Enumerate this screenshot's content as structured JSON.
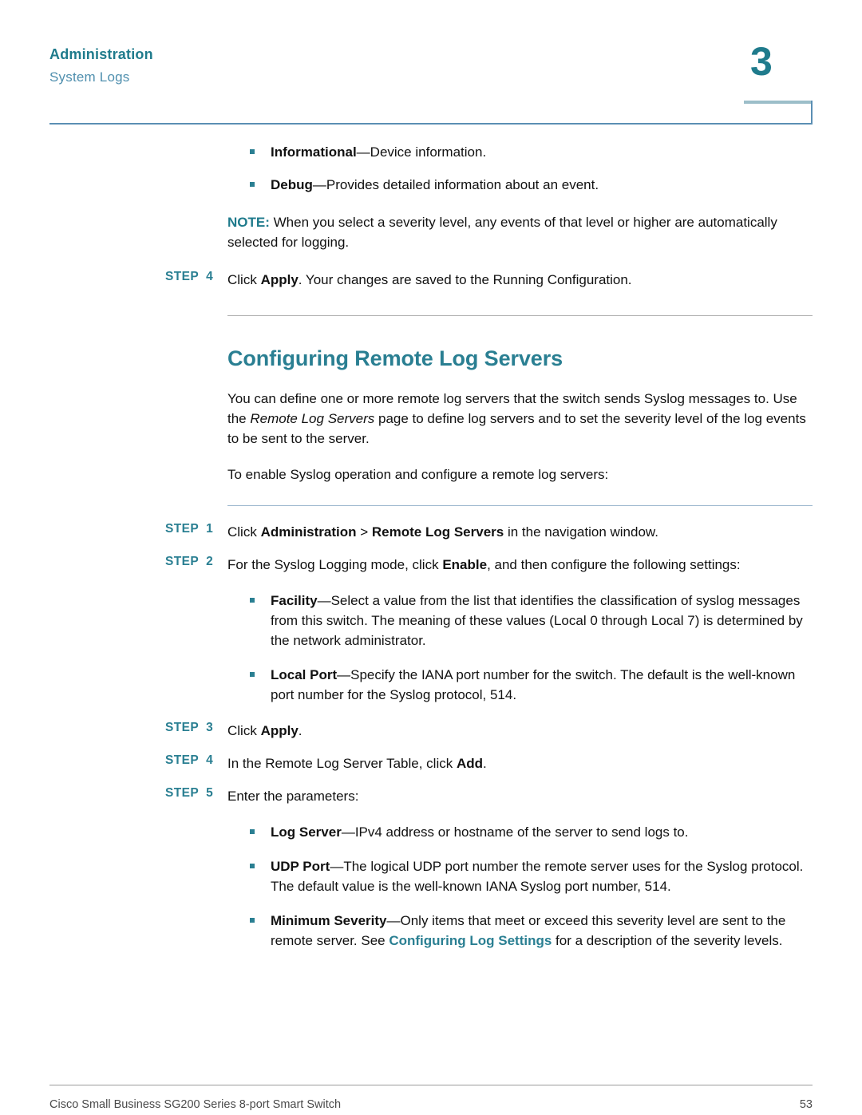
{
  "header": {
    "chapter_title": "Administration",
    "section_title": "System Logs",
    "chapter_number": "3"
  },
  "body": {
    "top_bullets": [
      {
        "term": "Informational",
        "dash": "—",
        "description": "Device information."
      },
      {
        "term": "Debug",
        "dash": "—",
        "description": "Provides detailed information about an event."
      }
    ],
    "note": {
      "label": "NOTE:",
      "text": " When you select a severity level, any events of that level or higher are automatically selected for logging."
    },
    "step_apply_top": {
      "label": "STEP",
      "number": "4",
      "text_before": "Click ",
      "bold": "Apply",
      "text_after": ". Your changes are saved to the Running Configuration."
    },
    "section": {
      "title": "Configuring Remote Log Servers",
      "intro_para_1_a": "You can define one or more remote log servers that the switch sends Syslog messages to. Use the ",
      "intro_para_1_italic": "Remote Log Servers",
      "intro_para_1_b": " page to define log servers and to set the severity level of the log events to be sent to the server.",
      "intro_para_2": "To enable Syslog operation and configure a remote log servers:"
    },
    "steps": [
      {
        "label": "STEP",
        "number": "1",
        "parts": [
          {
            "t": "Click ",
            "style": "plain"
          },
          {
            "t": "Administration",
            "style": "bold"
          },
          {
            "t": " > ",
            "style": "plain"
          },
          {
            "t": "Remote Log Servers",
            "style": "bold"
          },
          {
            "t": " in the navigation window.",
            "style": "plain"
          }
        ]
      },
      {
        "label": "STEP",
        "number": "2",
        "parts": [
          {
            "t": "For the Syslog Logging mode, click ",
            "style": "plain"
          },
          {
            "t": "Enable",
            "style": "bold"
          },
          {
            "t": ", and then configure the following settings:",
            "style": "plain"
          }
        ]
      },
      {
        "label": "STEP",
        "number": "3",
        "parts": [
          {
            "t": "Click ",
            "style": "plain"
          },
          {
            "t": "Apply",
            "style": "bold"
          },
          {
            "t": ".",
            "style": "plain"
          }
        ]
      },
      {
        "label": "STEP",
        "number": "4",
        "parts": [
          {
            "t": "In the Remote Log Server Table, click ",
            "style": "plain"
          },
          {
            "t": "Add",
            "style": "bold"
          },
          {
            "t": ".",
            "style": "plain"
          }
        ]
      },
      {
        "label": "STEP",
        "number": "5",
        "parts": [
          {
            "t": "Enter the parameters:",
            "style": "plain"
          }
        ]
      }
    ],
    "settings_bullets": [
      {
        "term": "Facility",
        "dash": "—",
        "description": "Select a value from the list that identifies the classification of syslog messages from this switch. The meaning of these values (Local 0 through Local 7) is determined by the network administrator."
      },
      {
        "term": "Local Port",
        "dash": "—",
        "description": "Specify the IANA port number for the switch. The default is the well-known port number for the Syslog protocol, 514."
      }
    ],
    "parameter_bullets": [
      {
        "term": "Log Server",
        "dash": "—",
        "description": "IPv4 address or hostname of the server to send logs to."
      },
      {
        "term": "UDP Port",
        "dash": "—",
        "description": "The logical UDP port number the remote server uses for the Syslog protocol. The default value is the well-known IANA Syslog port number, 514."
      }
    ],
    "severity_bullet": {
      "term": "Minimum Severity",
      "dash": "—",
      "text_a": "Only items that meet or exceed this severity level are sent to the remote server. See ",
      "link": "Configuring Log Settings",
      "text_b": " for a description of the severity levels."
    }
  },
  "footer": {
    "product": "Cisco Small Business SG200 Series 8-port Smart Switch",
    "page_number": "53"
  },
  "colors": {
    "teal": "#2a7f92",
    "header_teal": "#1f7b8c",
    "subtitle_blue": "#4f8fae",
    "rule_blue": "#5b8fb4",
    "rule_gray": "#b0b0b0"
  }
}
